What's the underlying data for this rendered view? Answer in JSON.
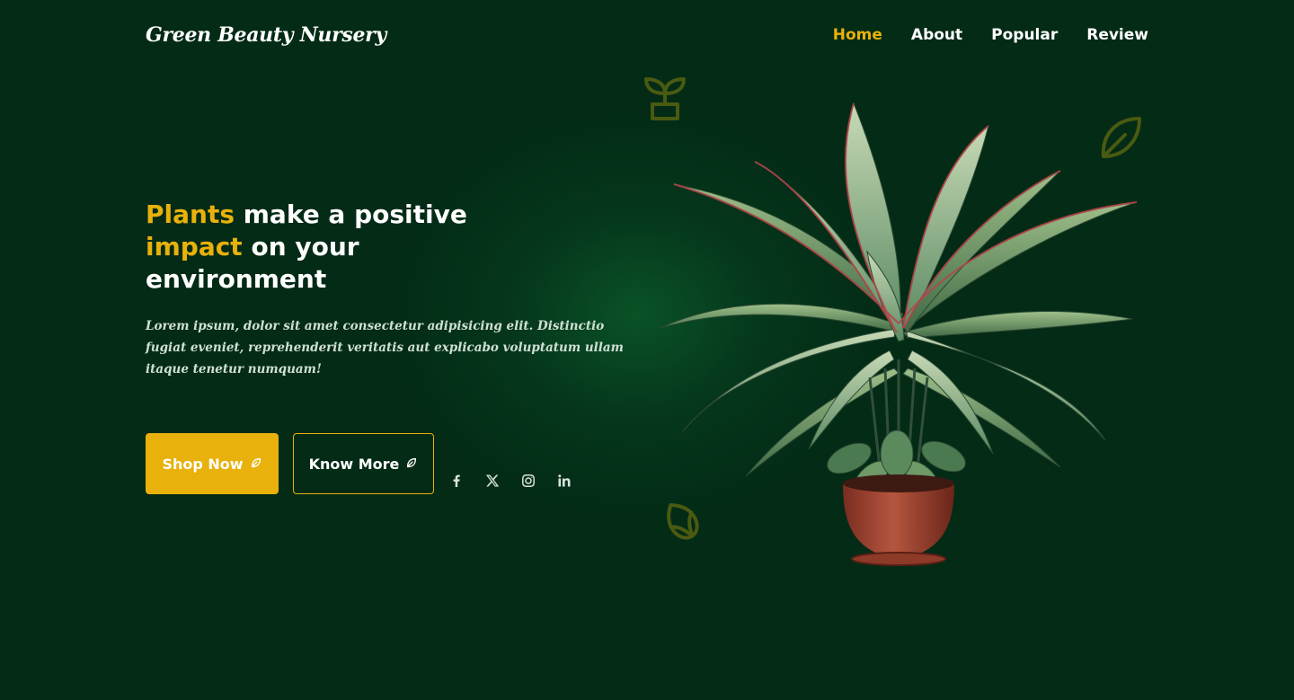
{
  "brand": {
    "logo": "Green Beauty Nursery"
  },
  "nav": {
    "items": [
      {
        "label": "Home",
        "active": true
      },
      {
        "label": "About",
        "active": false
      },
      {
        "label": "Popular",
        "active": false
      },
      {
        "label": "Review",
        "active": false
      }
    ]
  },
  "hero": {
    "title": {
      "part1": "Plants",
      "part2": " make a positive ",
      "part3": "impact",
      "part4": " on your environment"
    },
    "description": "Lorem ipsum, dolor sit amet consectetur adipisicing elit. Distinctio fugiat eveniet, reprehenderit veritatis aut explicabo voluptatum ullam itaque tenetur numquam!",
    "buttons": {
      "shop_label": "Shop Now",
      "more_label": "Know More",
      "icon": "leaf-icon"
    },
    "social": [
      "facebook-icon",
      "x-icon",
      "instagram-icon",
      "linkedin-icon"
    ]
  },
  "decorations": [
    "sprout-pot-icon",
    "leaf-icon",
    "tulip-icon"
  ],
  "image": {
    "subject": "potted-plant",
    "plant_icon": "plant-image"
  },
  "colors": {
    "background": "#032b16",
    "accent": "#e8b10b",
    "text": "#ffffff",
    "decoration": "#4a5a11"
  }
}
